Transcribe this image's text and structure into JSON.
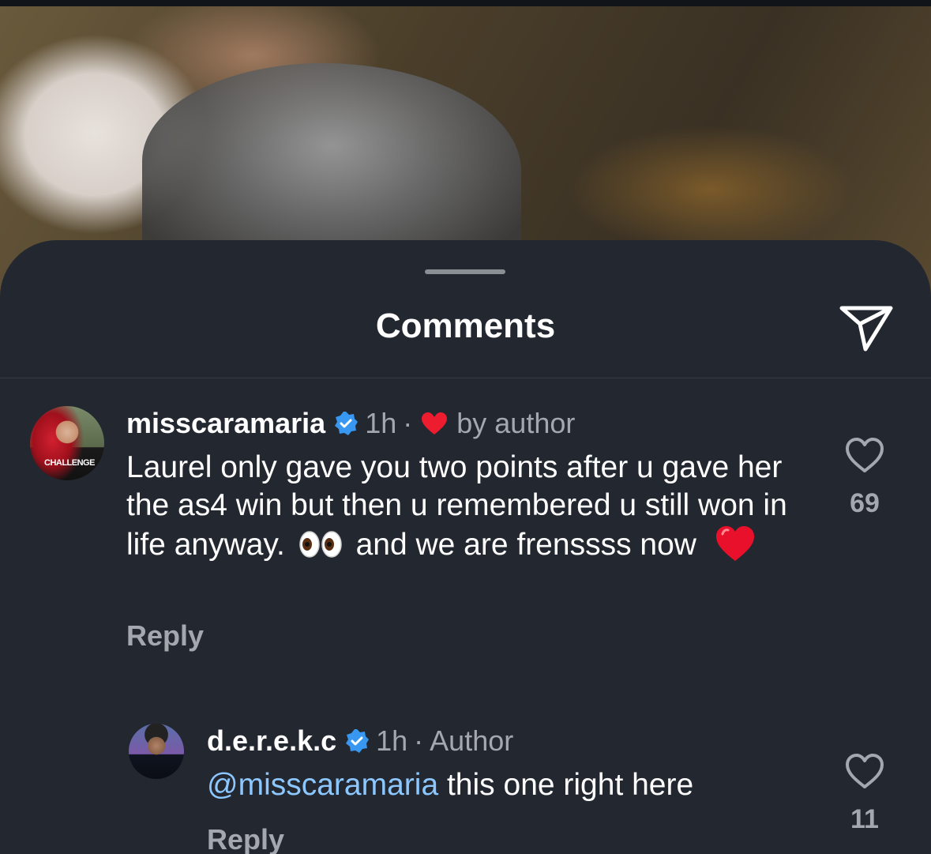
{
  "sheet": {
    "title": "Comments"
  },
  "comments": [
    {
      "username": "misscaramaria",
      "time": "1h",
      "separator": "·",
      "liked_by_label": "by author",
      "text_parts": {
        "part1": "Laurel only gave you two points after u gave her the as4 win but then u remembered u still won in life anyway.",
        "part2": "and we are frenssss now"
      },
      "emoji_1": "eyes",
      "emoji_2": "red-heart",
      "avatar_shirt_text": "CHALLENGE",
      "reply_label": "Reply",
      "like_count": "69"
    },
    {
      "username": "d.e.r.e.k.c",
      "time": "1h",
      "separator": "·",
      "author_label": "Author",
      "mention": "@misscaramaria",
      "text": " this one right here",
      "reply_label": "Reply",
      "like_count": "11"
    }
  ],
  "colors": {
    "sheet_bg": "#232730",
    "muted_text": "#a4a8ae",
    "mention": "#8cc8ff",
    "verified": "#3897f0",
    "heart": "#ed1c2e"
  },
  "icons": {
    "share": "paper-plane-icon",
    "verified": "verified-badge-icon",
    "like": "heart-outline-icon"
  }
}
